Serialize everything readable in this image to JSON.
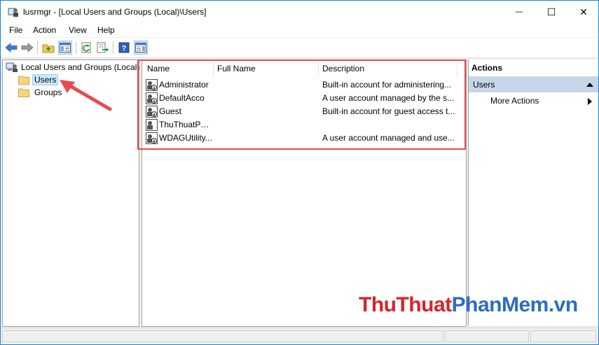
{
  "window": {
    "title": "lusrmgr - [Local Users and Groups (Local)\\Users]",
    "controls": {
      "minimize": "—",
      "maximize": "☐",
      "close": "✕"
    }
  },
  "menu": [
    "File",
    "Action",
    "View",
    "Help"
  ],
  "toolbar_icons": [
    "back-arrow-icon",
    "forward-arrow-icon",
    "up-folder-icon",
    "show-hide-tree-icon",
    "refresh-icon",
    "export-list-icon",
    "help-icon",
    "show-hide-action-pane-icon"
  ],
  "tree": {
    "root": "Local Users and Groups (Local)",
    "items": [
      "Users",
      "Groups"
    ],
    "selected": "Users"
  },
  "list": {
    "columns": [
      "Name",
      "Full Name",
      "Description"
    ],
    "rows": [
      {
        "name": "Administrator",
        "full_name": "",
        "description": "Built-in account for administering..."
      },
      {
        "name": "DefaultAcco",
        "full_name": "",
        "description": "A user account managed by the s..."
      },
      {
        "name": "Guest",
        "full_name": "",
        "description": "Built-in account for guest access t..."
      },
      {
        "name": "ThuThuatPh...",
        "full_name": "",
        "description": ""
      },
      {
        "name": "WDAGUtility...",
        "full_name": "",
        "description": "A user account managed and use..."
      }
    ]
  },
  "actions": {
    "header": "Actions",
    "section": "Users",
    "items": [
      "More Actions"
    ]
  },
  "watermark": {
    "part1": "ThuThuat",
    "part2": "PhanMem",
    "part3": ".vn"
  },
  "colors": {
    "highlight_border": "#e74b4f",
    "arrow": "#e74b4f",
    "selection": "#cce8ff",
    "actions_section": "#c6d6e8",
    "watermark_red": "#d8232a",
    "watermark_blue": "#2a6ec0"
  }
}
